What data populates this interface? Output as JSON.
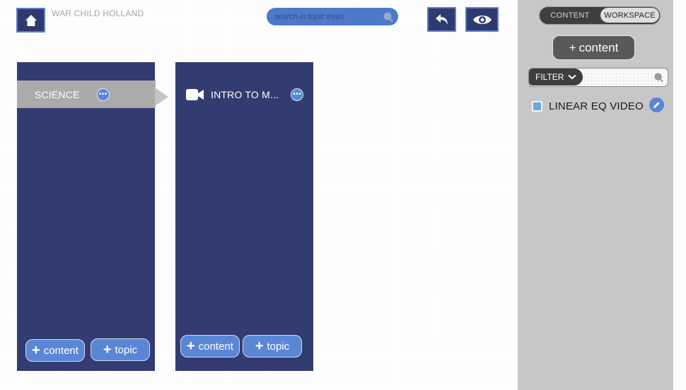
{
  "header": {
    "org_name": "WAR CHILD HOLLAND",
    "search_placeholder": "search in topic trees",
    "icons": {
      "home": "home-icon",
      "undo": "undo-icon",
      "preview": "eye-icon",
      "search": "search-icon"
    }
  },
  "columns": [
    {
      "items": [
        {
          "label": "SCIENCE",
          "selected": true,
          "icon": "more-icon"
        }
      ],
      "add_content_label": "content",
      "add_topic_label": "topic"
    },
    {
      "items": [
        {
          "label": "INTRO TO M...",
          "type_icon": "video-camera-icon",
          "icon": "more-icon"
        }
      ],
      "add_content_label": "content",
      "add_topic_label": "topic"
    }
  ],
  "sidebar": {
    "toggle": {
      "content_label": "CONTENT",
      "workspace_label": "WORKSPACE",
      "active": "WORKSPACE"
    },
    "add_content_label": "content",
    "filter_label": "FILTER",
    "items": [
      {
        "title": "LINEAR EQ VIDEO",
        "edit_icon": "pencil-icon"
      }
    ]
  },
  "colors": {
    "navy": "#323c70",
    "accent_blue": "#5a86d6",
    "sidebar_bg": "#c7c7c7",
    "selected_row": "#ababab"
  }
}
